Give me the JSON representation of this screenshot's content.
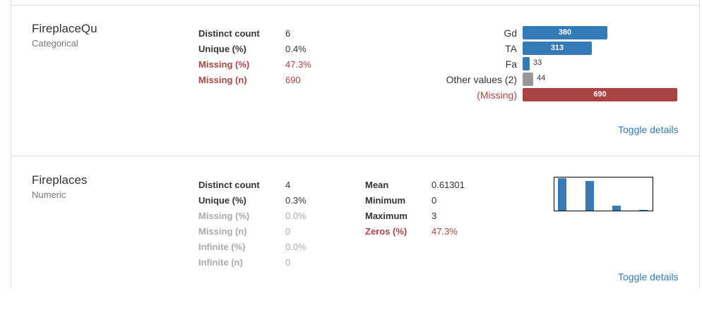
{
  "variables": [
    {
      "name": "FireplaceQu",
      "type": "Categorical",
      "stats": [
        {
          "label": "Distinct count",
          "value": "6",
          "state": "normal"
        },
        {
          "label": "Unique (%)",
          "value": "0.4%",
          "state": "normal"
        },
        {
          "label": "Missing (%)",
          "value": "47.3%",
          "state": "alert"
        },
        {
          "label": "Missing (n)",
          "value": "690",
          "state": "alert"
        }
      ],
      "frequencies": [
        {
          "label": "Gd",
          "count": "380",
          "color": "#337ab7",
          "state": "normal"
        },
        {
          "label": "TA",
          "count": "313",
          "color": "#337ab7",
          "state": "normal"
        },
        {
          "label": "Fa",
          "count": "33",
          "color": "#337ab7",
          "state": "normal"
        },
        {
          "label": "Other values (2)",
          "count": "44",
          "color": "#999999",
          "state": "normal"
        },
        {
          "label": "(Missing)",
          "count": "690",
          "color": "#a94442",
          "state": "alert"
        }
      ],
      "toggle_label": "Toggle details"
    },
    {
      "name": "Fireplaces",
      "type": "Numeric",
      "stats_left": [
        {
          "label": "Distinct count",
          "value": "4",
          "state": "normal"
        },
        {
          "label": "Unique (%)",
          "value": "0.3%",
          "state": "normal"
        },
        {
          "label": "Missing (%)",
          "value": "0.0%",
          "state": "ignore"
        },
        {
          "label": "Missing (n)",
          "value": "0",
          "state": "ignore"
        },
        {
          "label": "Infinite (%)",
          "value": "0.0%",
          "state": "ignore"
        },
        {
          "label": "Infinite (n)",
          "value": "0",
          "state": "ignore"
        }
      ],
      "stats_right": [
        {
          "label": "Mean",
          "value": "0.61301",
          "state": "normal"
        },
        {
          "label": "Minimum",
          "value": "0",
          "state": "normal"
        },
        {
          "label": "Maximum",
          "value": "3",
          "state": "normal"
        },
        {
          "label": "Zeros (%)",
          "value": "47.3%",
          "state": "alert"
        }
      ],
      "histogram_fractions": [
        1.0,
        0.92,
        0.16,
        0.02
      ],
      "toggle_label": "Toggle details"
    }
  ],
  "colors": {
    "accent": "#337ab7",
    "alert": "#a94442",
    "muted": "#999999"
  }
}
